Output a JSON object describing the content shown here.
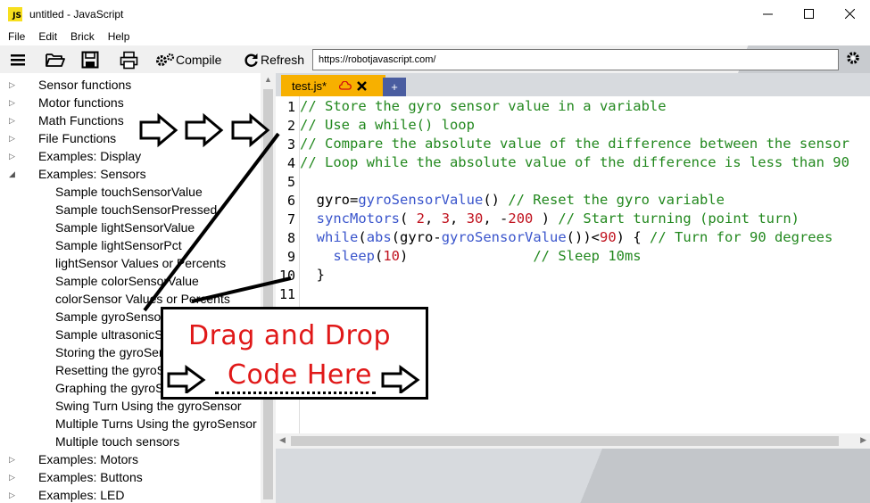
{
  "window": {
    "title": "untitled - JavaScript",
    "app_icon": "JS"
  },
  "menu": [
    "File",
    "Edit",
    "Brick",
    "Help"
  ],
  "toolbar": {
    "compile_label": "Compile",
    "refresh_label": "Refresh",
    "url": "https://robotjavascript.com/"
  },
  "tree": [
    {
      "label": "Sensor functions",
      "level": 0,
      "expanded": false
    },
    {
      "label": "Motor functions",
      "level": 0,
      "expanded": false
    },
    {
      "label": "Math Functions",
      "level": 0,
      "expanded": false
    },
    {
      "label": "File Functions",
      "level": 0,
      "expanded": false
    },
    {
      "label": "Examples: Display",
      "level": 0,
      "expanded": false
    },
    {
      "label": "Examples: Sensors",
      "level": 0,
      "expanded": true
    },
    {
      "label": "Sample touchSensorValue",
      "level": 1
    },
    {
      "label": "Sample touchSensorPressed",
      "level": 1
    },
    {
      "label": "Sample lightSensorValue",
      "level": 1
    },
    {
      "label": "Sample lightSensorPct",
      "level": 1
    },
    {
      "label": "lightSensor Values or Percents",
      "level": 1
    },
    {
      "label": "Sample colorSensorValue",
      "level": 1
    },
    {
      "label": "colorSensor Values or Percents",
      "level": 1
    },
    {
      "label": "Sample gyroSensorValue",
      "level": 1
    },
    {
      "label": "Sample ultrasonicSensor",
      "level": 1
    },
    {
      "label": "Storing the gyroSensor",
      "level": 1
    },
    {
      "label": "Resetting the gyroSensor",
      "level": 1
    },
    {
      "label": "Graphing the gyroSensor",
      "level": 1
    },
    {
      "label": "Swing Turn Using the gyroSensor",
      "level": 1
    },
    {
      "label": "Multiple Turns Using the gyroSensor",
      "level": 1
    },
    {
      "label": "Multiple touch sensors",
      "level": 1
    },
    {
      "label": "Examples: Motors",
      "level": 0,
      "expanded": false
    },
    {
      "label": "Examples: Buttons",
      "level": 0,
      "expanded": false
    },
    {
      "label": "Examples: LED",
      "level": 0,
      "expanded": false
    }
  ],
  "tab": {
    "name": "test.js*",
    "new_tab_label": "+"
  },
  "code": {
    "line_numbers": [
      "1",
      "2",
      "3",
      "4",
      "5",
      "6",
      "7",
      "8",
      "9",
      "10",
      "11"
    ],
    "lines": [
      [
        [
          "c",
          "// Store the gyro sensor value in a variable"
        ]
      ],
      [
        [
          "c",
          "// Use a while() loop"
        ]
      ],
      [
        [
          "c",
          "// Compare the absolute value of the difference between the sensor"
        ]
      ],
      [
        [
          "c",
          "// Loop while the absolute value of the difference is less than 90"
        ]
      ],
      [],
      [
        [
          "t",
          "  gyro="
        ],
        [
          "f",
          "gyroSensorValue"
        ],
        [
          "t",
          "() "
        ],
        [
          "c",
          "// Reset the gyro variable"
        ]
      ],
      [
        [
          "t",
          "  "
        ],
        [
          "f",
          "syncMotors"
        ],
        [
          "t",
          "( "
        ],
        [
          "n",
          "2"
        ],
        [
          "t",
          ", "
        ],
        [
          "n",
          "3"
        ],
        [
          "t",
          ", "
        ],
        [
          "n",
          "30"
        ],
        [
          "t",
          ", -"
        ],
        [
          "n",
          "200"
        ],
        [
          "t",
          " ) "
        ],
        [
          "c",
          "// Start turning (point turn)"
        ]
      ],
      [
        [
          "t",
          "  "
        ],
        [
          "f",
          "while"
        ],
        [
          "t",
          "("
        ],
        [
          "f",
          "abs"
        ],
        [
          "t",
          "(gyro-"
        ],
        [
          "f",
          "gyroSensorValue"
        ],
        [
          "t",
          "())<"
        ],
        [
          "n",
          "90"
        ],
        [
          "t",
          ") { "
        ],
        [
          "c",
          "// Turn for 90 degrees"
        ]
      ],
      [
        [
          "t",
          "    "
        ],
        [
          "f",
          "sleep"
        ],
        [
          "t",
          "("
        ],
        [
          "n",
          "10"
        ],
        [
          "t",
          ")               "
        ],
        [
          "c",
          "// Sleep 10ms"
        ]
      ],
      [
        [
          "t",
          "  }"
        ]
      ],
      []
    ]
  },
  "overlay": {
    "title": "Drag and Drop",
    "subtitle": "Code Here"
  },
  "colors": {
    "tab_active": "#f7b000",
    "tab_new": "#4a5da0",
    "comment": "#22881e",
    "function": "#3a55cc",
    "number": "#c0121e",
    "annotation": "#e01818"
  }
}
